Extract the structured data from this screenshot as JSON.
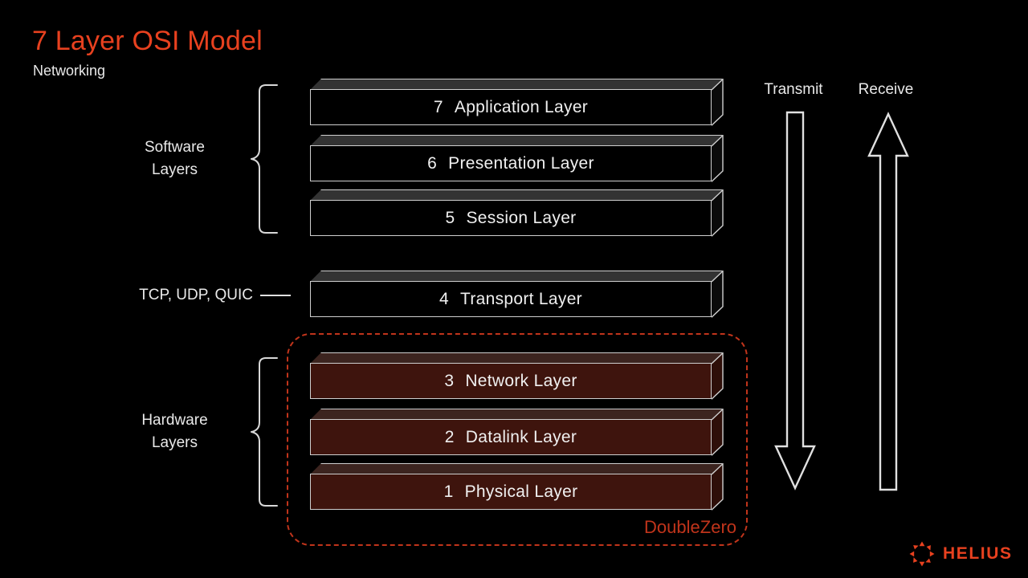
{
  "slide": {
    "title": "7 Layer OSI Model",
    "subtitle": "Networking",
    "background_color": "#000000",
    "accent_color": "#e8411f"
  },
  "layers": [
    {
      "num": "7",
      "name": "Application Layer",
      "group": "software"
    },
    {
      "num": "6",
      "name": "Presentation Layer",
      "group": "software"
    },
    {
      "num": "5",
      "name": "Session Layer",
      "group": "software"
    },
    {
      "num": "4",
      "name": "Transport Layer",
      "group": "transport"
    },
    {
      "num": "3",
      "name": "Network Layer",
      "group": "hardware"
    },
    {
      "num": "2",
      "name": "Datalink Layer",
      "group": "hardware"
    },
    {
      "num": "1",
      "name": "Physical Layer",
      "group": "hardware"
    }
  ],
  "annotations": {
    "software_group": "Software\nLayers",
    "transport_protocols": "TCP, UDP, QUIC",
    "hardware_group": "Hardware\nLayers",
    "doublezero": "DoubleZero",
    "doublezero_color": "#c0341b"
  },
  "flow": {
    "transmit_label": "Transmit",
    "receive_label": "Receive"
  },
  "brand": {
    "name": "HELIUS",
    "color": "#e8411f",
    "mark": "sun-burst-icon"
  }
}
